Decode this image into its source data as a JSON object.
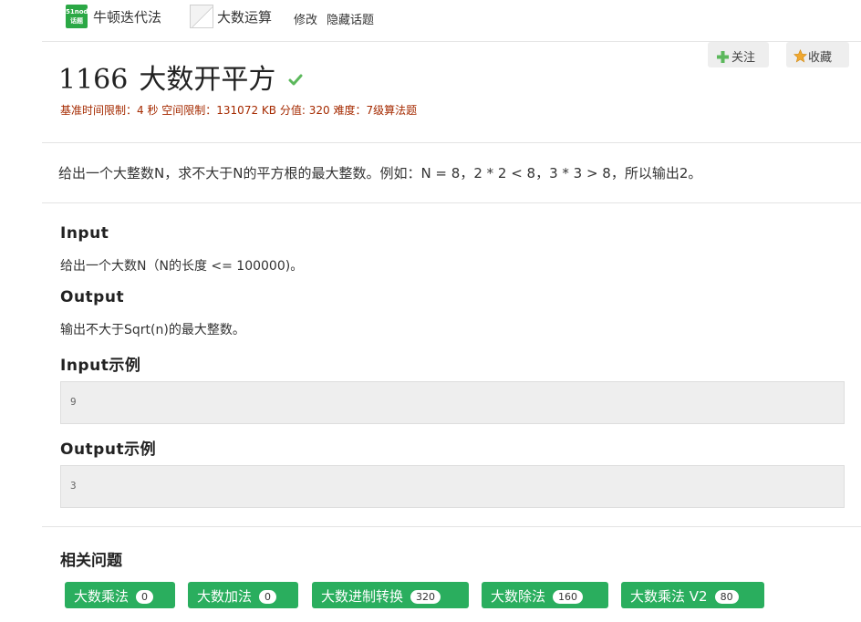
{
  "topbar": {
    "tag1": {
      "logo_line1": "51nod",
      "logo_line2": "话题",
      "label": "牛顿迭代法"
    },
    "tag2": {
      "label": "大数运算"
    },
    "edit_link": "修改",
    "hide_link": "隐藏话题"
  },
  "actions": {
    "follow": "关注",
    "favorite": "收藏"
  },
  "problem": {
    "id": "1166",
    "title": "大数开平方",
    "limits": {
      "time": "基准时间限制：4 秒",
      "space": "空间限制：131072 KB",
      "score": "分值: 320",
      "difficulty": "难度：7级算法题"
    },
    "description": "给出一个大整数N，求不大于N的平方根的最大整数。例如：N = 8，2 * 2 < 8，3 * 3 > 8，所以输出2。",
    "input_heading": "Input",
    "input_text": "给出一个大数N（N的长度 <= 100000)。",
    "output_heading": "Output",
    "output_text": "输出不大于Sqrt(n)的最大整数。",
    "input_example_heading": "Input示例",
    "input_example": "9",
    "output_example_heading": "Output示例",
    "output_example": "3"
  },
  "related": {
    "heading": "相关问题",
    "items": [
      {
        "label": "大数乘法",
        "count": "0"
      },
      {
        "label": "大数加法",
        "count": "0"
      },
      {
        "label": "大数进制转换",
        "count": "320"
      },
      {
        "label": "大数除法",
        "count": "160"
      },
      {
        "label": "大数乘法 V2",
        "count": "80"
      }
    ]
  },
  "colors": {
    "accent_green": "#2aae5e",
    "limits_red": "#a52a00",
    "logo_green": "#2ba845"
  }
}
